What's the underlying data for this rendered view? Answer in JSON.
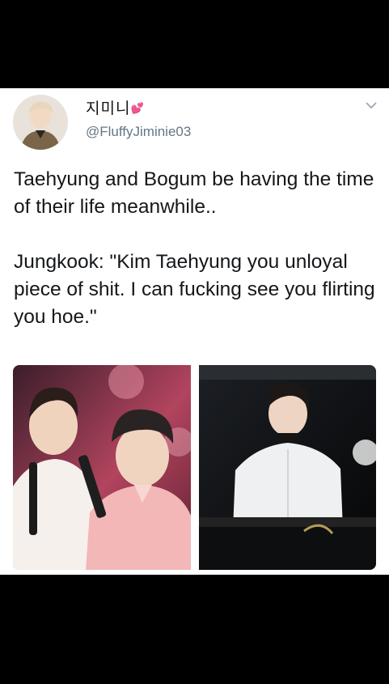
{
  "tweet": {
    "display_name": "지미니",
    "heart_emoji": "💕",
    "handle": "@FluffyJiminie03",
    "paragraphs": [
      "Taehyung and Bogum be having the time of their life meanwhile..",
      "Jungkook: \"Kim Taehyung you unloyal piece of shit. I can fucking see you flirting you hoe.\""
    ],
    "menu_icon": "chevron-down-icon"
  },
  "colors": {
    "background": "#000000",
    "card": "#ffffff",
    "text": "#14171a",
    "handle": "#657786",
    "heart": "#e64c9d"
  }
}
